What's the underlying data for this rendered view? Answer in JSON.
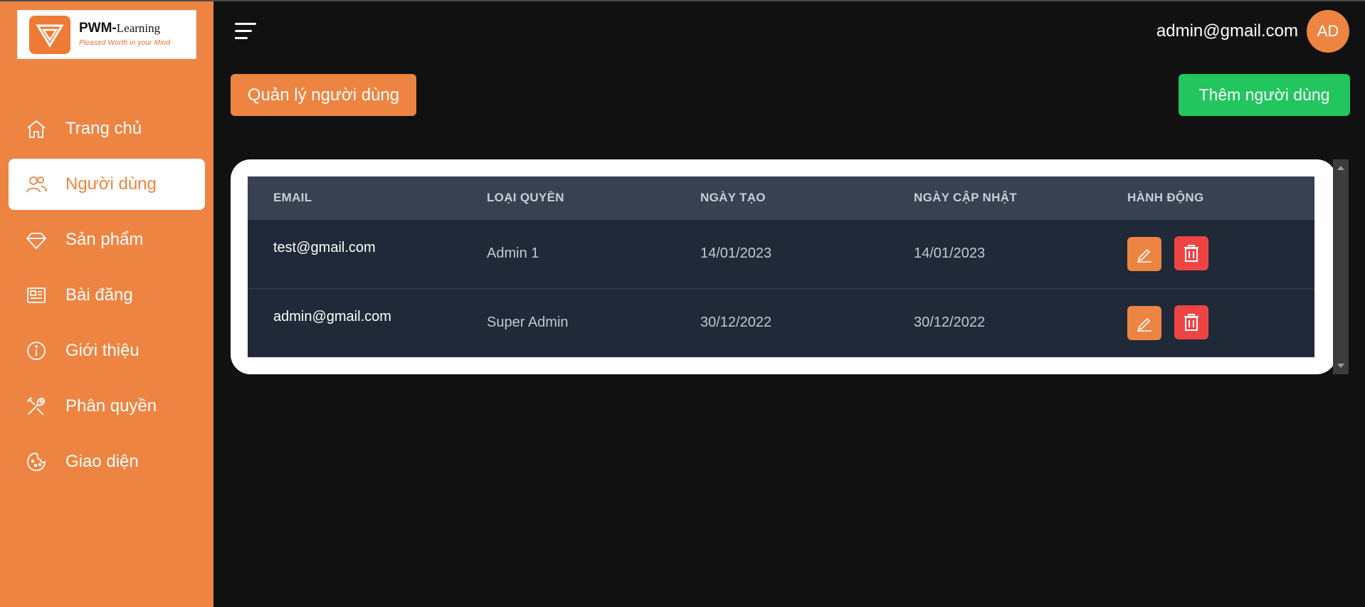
{
  "brand": {
    "name_bold": "PWM-",
    "name_thin": "Learning",
    "slogan": "Pleased Worth in your Mind"
  },
  "sidebar": {
    "items": [
      {
        "label": "Trang chủ",
        "icon": "home-icon",
        "active": false
      },
      {
        "label": "Người dùng",
        "icon": "users-icon",
        "active": true
      },
      {
        "label": "Sản phẩm",
        "icon": "diamond-icon",
        "active": false
      },
      {
        "label": "Bài đăng",
        "icon": "newspaper-icon",
        "active": false
      },
      {
        "label": "Giới thiệu",
        "icon": "info-icon",
        "active": false
      },
      {
        "label": "Phân quyền",
        "icon": "tools-icon",
        "active": false
      },
      {
        "label": "Giao diện",
        "icon": "palette-icon",
        "active": false
      }
    ]
  },
  "header": {
    "user_email": "admin@gmail.com",
    "avatar_initials": "AD"
  },
  "main": {
    "title_button": "Quản lý người dùng",
    "add_button": "Thêm người dùng",
    "table": {
      "columns": [
        "EMAIL",
        "LOẠI QUYỀN",
        "NGÀY TẠO",
        "NGÀY CẬP NHẬT",
        "HÀNH ĐỘNG"
      ],
      "rows": [
        {
          "email": "test@gmail.com",
          "role": "Admin 1",
          "created": "14/01/2023",
          "updated": "14/01/2023"
        },
        {
          "email": "admin@gmail.com",
          "role": "Super Admin",
          "created": "30/12/2022",
          "updated": "30/12/2022"
        }
      ]
    }
  },
  "colors": {
    "accent": "#ee8442",
    "success": "#22c55e",
    "danger": "#ef4444",
    "background": "#111111",
    "table_header": "#374151",
    "table_row": "#1f2937"
  }
}
